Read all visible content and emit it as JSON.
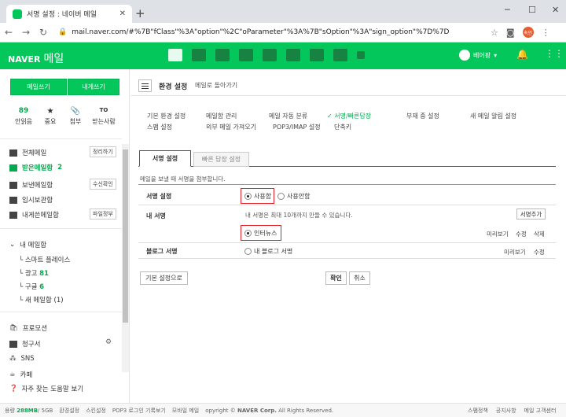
{
  "browser": {
    "tab_title": "서명 설정 : 네이버 메일",
    "new_tab": "+",
    "url": "mail.naver.com/#%7B\"fClass\"%3A\"option\"%2C\"oParameter\"%3A%7B\"sOption\"%3A\"sign_option\"%7D%7D",
    "profile_label": "속인",
    "colors": {
      "tabstrip": "#dee1e6"
    }
  },
  "header": {
    "brand": "NAVER",
    "product": "메일",
    "user_name": "베어팡",
    "colors": {
      "brand_green": "#03c75a"
    }
  },
  "sidebar": {
    "write_label": "메일쓰기",
    "self_label": "내게쓰기",
    "stats": [
      {
        "count": "89",
        "label": "안읽음",
        "icon": ""
      },
      {
        "count": "",
        "label": "중요",
        "icon": "★"
      },
      {
        "count": "",
        "label": "첨부",
        "icon": "📎"
      },
      {
        "count": "",
        "label": "받는사람",
        "icon": "TO"
      }
    ],
    "folders": [
      {
        "label": "전체메일",
        "count": "",
        "button": "정리하기"
      },
      {
        "label": "받은메일함",
        "count": "2",
        "button": ""
      },
      {
        "label": "보낸메일함",
        "count": "",
        "button": "수신확인"
      },
      {
        "label": "임시보관함",
        "count": "",
        "button": ""
      },
      {
        "label": "내게쓴메일함",
        "count": "",
        "button": "파일정부"
      }
    ],
    "my_mailbox_label": "내 메일함",
    "subfolders": [
      {
        "label": "스마트 플레이스",
        "count": ""
      },
      {
        "label": "광고",
        "count": "81"
      },
      {
        "label": "구글",
        "count": "6"
      },
      {
        "label": "새 메일함 (1)",
        "count": ""
      }
    ],
    "extras": [
      "프로모션",
      "청구서",
      "SNS",
      "카페"
    ],
    "faq": "자주 찾는 도움말 보기"
  },
  "settings": {
    "title": "환경 설정",
    "subtitle": "메일로 돌아가기",
    "nav_row1": [
      "기본 환경 설정",
      "메일함 관리",
      "메일 자동 분류",
      "✓ 서명/빠른답장",
      "부재 중 설정",
      "새 메일 알림 설정"
    ],
    "nav_row2": [
      "스팸 설정",
      "외부 메일 가져오기",
      "POP3/IMAP 설정",
      "단축키"
    ],
    "tabs": [
      "서명 설정",
      "빠른 답장 설정"
    ],
    "description": "메일을 보낼 때 서명을 첨부합니다.",
    "sign_setting_label": "서명 설정",
    "use_label": "사용함",
    "not_use_label": "사용안함",
    "my_sign_label": "내 서명",
    "my_sign_info": "내 서명은 최대 10개까지 만들 수 있습니다.",
    "my_sign_info_count": "10",
    "add_sign_label": "서명추가",
    "sign_name": "인터뉴스",
    "preview_label": "미리보기",
    "edit_label": "수정",
    "delete_label": "삭제",
    "blog_sign_label": "블로그 서명",
    "blog_option_label": "내 블로그 서명",
    "default_label": "기본 설정으로",
    "confirm_label": "확인",
    "cancel_label": "취소"
  },
  "footer": {
    "capacity": "용량",
    "used": "288MB",
    "total": "/ 5GB",
    "links": [
      "환경설정",
      "스킨설정",
      "POP3 로그인 기록보기",
      "모바일 메일",
      "opyright ©"
    ],
    "brand": "NAVER Corp.",
    "rights": "All Rights Reserved.",
    "right_links": [
      "스팸정책",
      "공지사항",
      "메일 고객센터"
    ]
  }
}
